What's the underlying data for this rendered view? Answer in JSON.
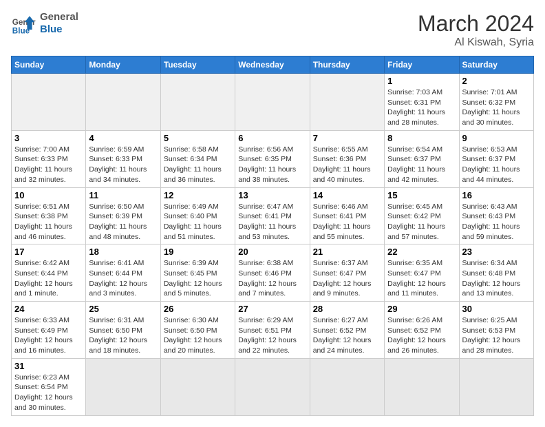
{
  "header": {
    "logo_general": "General",
    "logo_blue": "Blue",
    "month_title": "March 2024",
    "location": "Al Kiswah, Syria"
  },
  "columns": [
    "Sunday",
    "Monday",
    "Tuesday",
    "Wednesday",
    "Thursday",
    "Friday",
    "Saturday"
  ],
  "weeks": [
    [
      {
        "day": "",
        "info": ""
      },
      {
        "day": "",
        "info": ""
      },
      {
        "day": "",
        "info": ""
      },
      {
        "day": "",
        "info": ""
      },
      {
        "day": "",
        "info": ""
      },
      {
        "day": "1",
        "info": "Sunrise: 7:03 AM\nSunset: 6:31 PM\nDaylight: 11 hours and 28 minutes."
      },
      {
        "day": "2",
        "info": "Sunrise: 7:01 AM\nSunset: 6:32 PM\nDaylight: 11 hours and 30 minutes."
      }
    ],
    [
      {
        "day": "3",
        "info": "Sunrise: 7:00 AM\nSunset: 6:33 PM\nDaylight: 11 hours and 32 minutes."
      },
      {
        "day": "4",
        "info": "Sunrise: 6:59 AM\nSunset: 6:33 PM\nDaylight: 11 hours and 34 minutes."
      },
      {
        "day": "5",
        "info": "Sunrise: 6:58 AM\nSunset: 6:34 PM\nDaylight: 11 hours and 36 minutes."
      },
      {
        "day": "6",
        "info": "Sunrise: 6:56 AM\nSunset: 6:35 PM\nDaylight: 11 hours and 38 minutes."
      },
      {
        "day": "7",
        "info": "Sunrise: 6:55 AM\nSunset: 6:36 PM\nDaylight: 11 hours and 40 minutes."
      },
      {
        "day": "8",
        "info": "Sunrise: 6:54 AM\nSunset: 6:37 PM\nDaylight: 11 hours and 42 minutes."
      },
      {
        "day": "9",
        "info": "Sunrise: 6:53 AM\nSunset: 6:37 PM\nDaylight: 11 hours and 44 minutes."
      }
    ],
    [
      {
        "day": "10",
        "info": "Sunrise: 6:51 AM\nSunset: 6:38 PM\nDaylight: 11 hours and 46 minutes."
      },
      {
        "day": "11",
        "info": "Sunrise: 6:50 AM\nSunset: 6:39 PM\nDaylight: 11 hours and 48 minutes."
      },
      {
        "day": "12",
        "info": "Sunrise: 6:49 AM\nSunset: 6:40 PM\nDaylight: 11 hours and 51 minutes."
      },
      {
        "day": "13",
        "info": "Sunrise: 6:47 AM\nSunset: 6:41 PM\nDaylight: 11 hours and 53 minutes."
      },
      {
        "day": "14",
        "info": "Sunrise: 6:46 AM\nSunset: 6:41 PM\nDaylight: 11 hours and 55 minutes."
      },
      {
        "day": "15",
        "info": "Sunrise: 6:45 AM\nSunset: 6:42 PM\nDaylight: 11 hours and 57 minutes."
      },
      {
        "day": "16",
        "info": "Sunrise: 6:43 AM\nSunset: 6:43 PM\nDaylight: 11 hours and 59 minutes."
      }
    ],
    [
      {
        "day": "17",
        "info": "Sunrise: 6:42 AM\nSunset: 6:44 PM\nDaylight: 12 hours and 1 minute."
      },
      {
        "day": "18",
        "info": "Sunrise: 6:41 AM\nSunset: 6:44 PM\nDaylight: 12 hours and 3 minutes."
      },
      {
        "day": "19",
        "info": "Sunrise: 6:39 AM\nSunset: 6:45 PM\nDaylight: 12 hours and 5 minutes."
      },
      {
        "day": "20",
        "info": "Sunrise: 6:38 AM\nSunset: 6:46 PM\nDaylight: 12 hours and 7 minutes."
      },
      {
        "day": "21",
        "info": "Sunrise: 6:37 AM\nSunset: 6:47 PM\nDaylight: 12 hours and 9 minutes."
      },
      {
        "day": "22",
        "info": "Sunrise: 6:35 AM\nSunset: 6:47 PM\nDaylight: 12 hours and 11 minutes."
      },
      {
        "day": "23",
        "info": "Sunrise: 6:34 AM\nSunset: 6:48 PM\nDaylight: 12 hours and 13 minutes."
      }
    ],
    [
      {
        "day": "24",
        "info": "Sunrise: 6:33 AM\nSunset: 6:49 PM\nDaylight: 12 hours and 16 minutes."
      },
      {
        "day": "25",
        "info": "Sunrise: 6:31 AM\nSunset: 6:50 PM\nDaylight: 12 hours and 18 minutes."
      },
      {
        "day": "26",
        "info": "Sunrise: 6:30 AM\nSunset: 6:50 PM\nDaylight: 12 hours and 20 minutes."
      },
      {
        "day": "27",
        "info": "Sunrise: 6:29 AM\nSunset: 6:51 PM\nDaylight: 12 hours and 22 minutes."
      },
      {
        "day": "28",
        "info": "Sunrise: 6:27 AM\nSunset: 6:52 PM\nDaylight: 12 hours and 24 minutes."
      },
      {
        "day": "29",
        "info": "Sunrise: 6:26 AM\nSunset: 6:52 PM\nDaylight: 12 hours and 26 minutes."
      },
      {
        "day": "30",
        "info": "Sunrise: 6:25 AM\nSunset: 6:53 PM\nDaylight: 12 hours and 28 minutes."
      }
    ],
    [
      {
        "day": "31",
        "info": "Sunrise: 6:23 AM\nSunset: 6:54 PM\nDaylight: 12 hours and 30 minutes."
      },
      {
        "day": "",
        "info": ""
      },
      {
        "day": "",
        "info": ""
      },
      {
        "day": "",
        "info": ""
      },
      {
        "day": "",
        "info": ""
      },
      {
        "day": "",
        "info": ""
      },
      {
        "day": "",
        "info": ""
      }
    ]
  ]
}
